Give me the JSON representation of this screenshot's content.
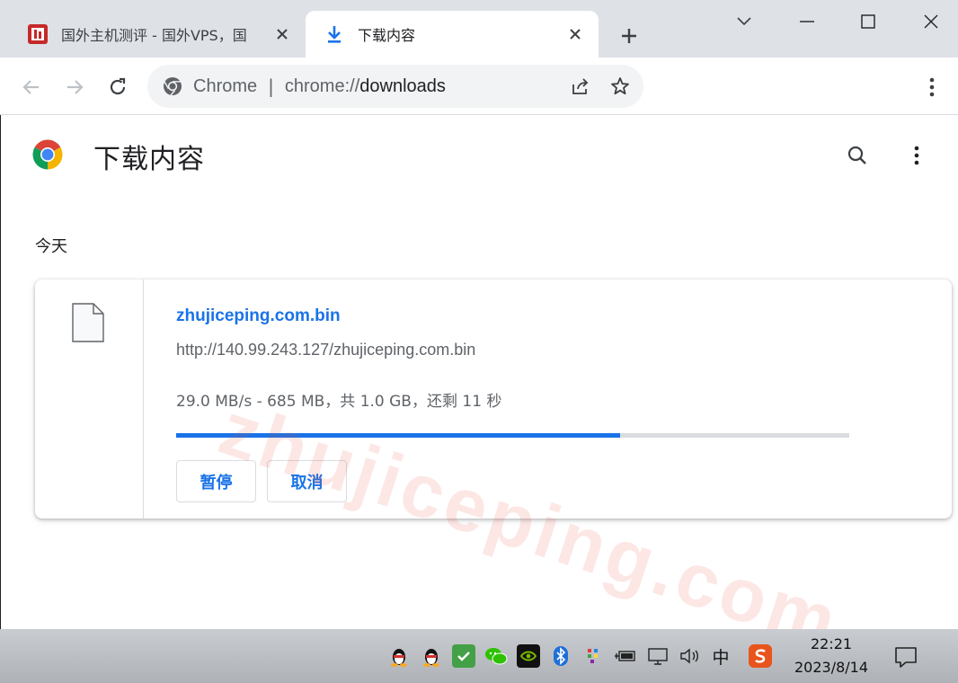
{
  "browser": {
    "tabs": [
      {
        "title": "国外主机测评 - 国外VPS，国",
        "active": false,
        "icon": "site-favicon"
      },
      {
        "title": "下载内容",
        "active": true,
        "icon": "download-icon"
      }
    ],
    "omnibox": {
      "site_name": "Chrome",
      "separator": "|",
      "url_scheme": "chrome://",
      "url_path": "downloads"
    }
  },
  "page": {
    "title": "下载内容",
    "section_date": "今天",
    "watermark": "zhujiceping.com"
  },
  "download": {
    "filename": "zhujiceping.com.bin",
    "url": "http://140.99.243.127/zhujiceping.com.bin",
    "status": "29.0 MB/s - 685 MB，共 1.0 GB，还剩 11 秒",
    "progress_percent": 66,
    "pause_label": "暂停",
    "cancel_label": "取消"
  },
  "taskbar": {
    "ime": "中",
    "time": "22:21",
    "date": "2023/8/14"
  },
  "colors": {
    "accent": "#1a73e8",
    "tabstrip": "#dee1e6",
    "watermark": "#ea4335"
  }
}
